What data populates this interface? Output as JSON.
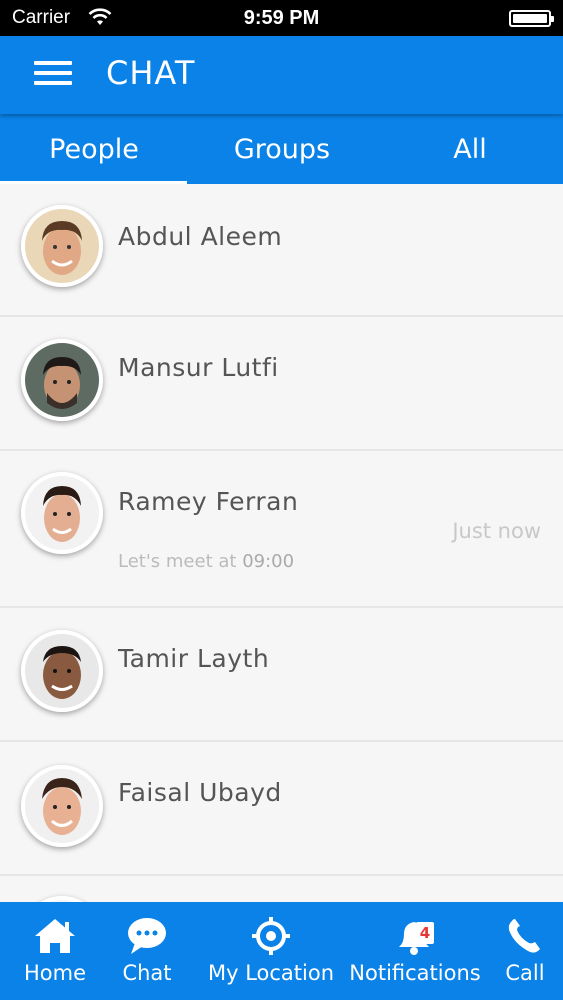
{
  "status_bar": {
    "carrier": "Carrier",
    "time": "9:59 PM",
    "icons": [
      "wifi-icon",
      "battery-icon"
    ]
  },
  "header": {
    "title": "CHAT",
    "menu_icon": "hamburger-menu-icon"
  },
  "tabs": [
    {
      "label": "People",
      "selected": true
    },
    {
      "label": "Groups",
      "selected": false
    },
    {
      "label": "All",
      "selected": false
    }
  ],
  "contacts": [
    {
      "name": "Abdul Aleem",
      "last_message_prefix": "",
      "last_message_time": "",
      "time": ""
    },
    {
      "name": "Mansur Lutfi",
      "last_message_prefix": "",
      "last_message_time": "",
      "time": ""
    },
    {
      "name": "Ramey Ferran",
      "last_message_prefix": "Let's meet at",
      "last_message_time": "09:00",
      "time": "Just now"
    },
    {
      "name": "Tamir Layth",
      "last_message_prefix": "",
      "last_message_time": "",
      "time": ""
    },
    {
      "name": "Faisal Ubayd",
      "last_message_prefix": "",
      "last_message_time": "",
      "time": ""
    }
  ],
  "bottom_nav": [
    {
      "label": "Home",
      "icon": "home-icon"
    },
    {
      "label": "Chat",
      "icon": "chat-bubble-icon"
    },
    {
      "label": "My Location",
      "icon": "location-target-icon"
    },
    {
      "label": "Notifications",
      "icon": "bell-icon",
      "badge": "4"
    },
    {
      "label": "Call",
      "icon": "phone-icon"
    }
  ],
  "colors": {
    "primary": "#0a82e8",
    "list_background": "#f6f6f7",
    "name_text": "#555555",
    "muted_text": "#bbbbbb",
    "badge_text": "#e53935"
  }
}
